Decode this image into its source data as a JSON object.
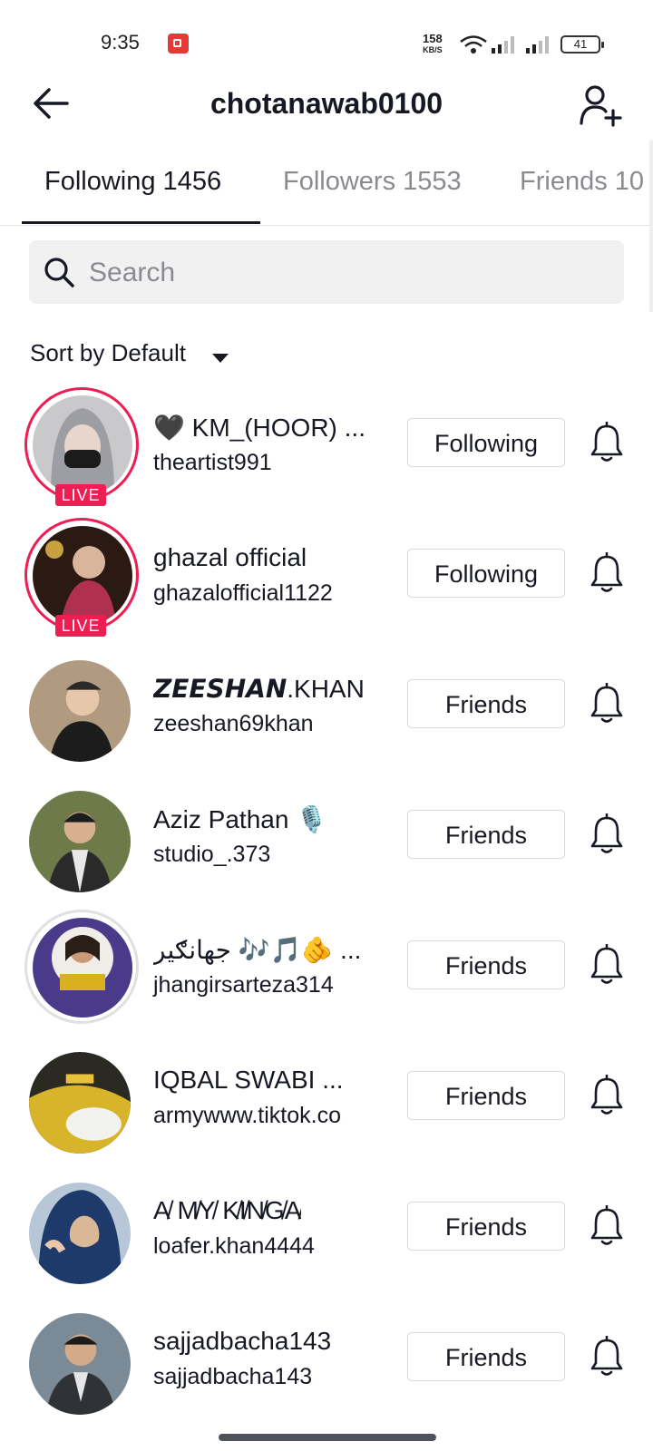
{
  "status_bar": {
    "time": "9:35",
    "net_speed_value": "158",
    "net_speed_unit": "KB/S",
    "battery": "41",
    "icons": [
      "screen-record-icon",
      "wifi-icon",
      "signal-icon",
      "signal-icon",
      "battery-icon"
    ]
  },
  "header": {
    "title": "chotanawab0100",
    "back_icon": "arrow-left-icon",
    "add_icon": "add-user-icon"
  },
  "tabs": [
    {
      "label": "Following 1456",
      "active": true
    },
    {
      "label": "Followers 1553",
      "active": false
    },
    {
      "label": "Friends 10",
      "active": false
    }
  ],
  "search": {
    "placeholder": "Search",
    "value": ""
  },
  "sort": {
    "label": "Sort by Default"
  },
  "users": [
    {
      "name": "🖤 KM_(HOOR) ...",
      "handle": "theartist991",
      "button": "Following",
      "live": true,
      "live_label": "LIVE",
      "avatar_color": "#9c9ea3"
    },
    {
      "name": "ghazal official",
      "handle": "ghazalofficial1122",
      "button": "Following",
      "live": true,
      "live_label": "LIVE",
      "avatar_color": "#5a2a2a"
    },
    {
      "name": "𝙕𝙀𝙀𝙎𝙃𝘼𝙉.KHAN",
      "handle": "zeeshan69khan",
      "button": "Friends",
      "live": false,
      "avatar_color": "#7a6a5a"
    },
    {
      "name": "Aziz Pathan 🎙️",
      "handle": "studio_.373",
      "button": "Friends",
      "live": false,
      "avatar_color": "#4a5a3a"
    },
    {
      "name": "جهانګیر 🎶🎵🫵 ...",
      "handle": "jhangirsarteza314",
      "button": "Friends",
      "live": false,
      "avatar_color": "#4a3a8a"
    },
    {
      "name": "IQBAL SWABI ...",
      "handle": "armywww.tiktok.co",
      "button": "Friends",
      "live": false,
      "avatar_color": "#c8a828"
    },
    {
      "name": "A̸ M̸Y̸ K̸I̸N̸G̸A̸",
      "handle": "loafer.khan4444",
      "button": "Friends",
      "live": false,
      "avatar_color": "#1e3a6a"
    },
    {
      "name": "sajjadbacha143",
      "handle": "sajjadbacha143",
      "button": "Friends",
      "live": false,
      "avatar_color": "#5a6a7a"
    }
  ],
  "bell_icon": "bell-icon"
}
